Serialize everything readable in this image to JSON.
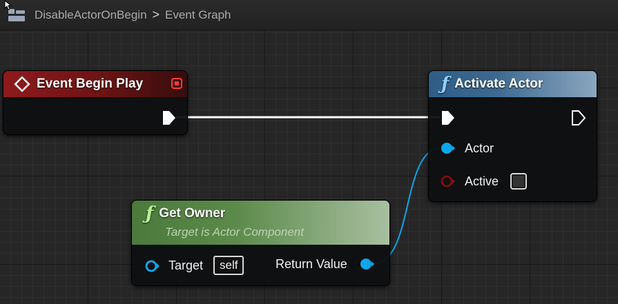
{
  "breadcrumb": {
    "blueprint": "DisableActorOnBegin",
    "separator": ">",
    "graph": "Event Graph"
  },
  "icons": {
    "breadcrumb": "blueprint-icon",
    "event": "event-diamond-icon",
    "function": "ƒ",
    "separator": "chevron-right-icon"
  },
  "colors": {
    "exec_wire": "#ffffff",
    "object_pin": "#0da6e8",
    "bool_pin": "#8b0c0c",
    "event_header": "#8e1a1c",
    "call_header": "#2f5d86",
    "pure_header": "#4b7a3c"
  },
  "nodes": {
    "event_begin_play": {
      "title": "Event Begin Play"
    },
    "activate_actor": {
      "title": "Activate Actor",
      "pins": {
        "actor": "Actor",
        "active": "Active"
      },
      "active_checked": false
    },
    "get_owner": {
      "title": "Get Owner",
      "subtitle": "Target is Actor Component",
      "pins": {
        "target": "Target",
        "target_default": "self",
        "return": "Return Value"
      }
    }
  }
}
